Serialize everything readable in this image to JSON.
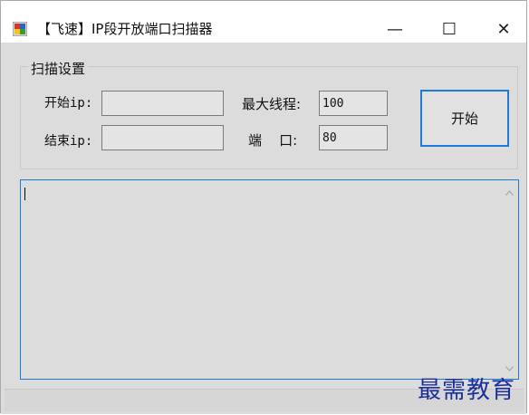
{
  "window": {
    "title": "【飞速】IP段开放端口扫描器",
    "minimize_glyph": "—",
    "maximize_glyph": "☐",
    "close_glyph": "✕"
  },
  "settings": {
    "group_title": "扫描设置",
    "start_ip_label": "开始ip:",
    "start_ip_value": "",
    "end_ip_label": "结束ip:",
    "end_ip_value": "",
    "threads_label": "最大线程:",
    "threads_value": "100",
    "port_label": "端    口:",
    "port_value": "80",
    "start_button": "开始"
  },
  "log": {
    "text": ""
  },
  "watermark": "最需教育",
  "colors": {
    "accent": "#1f7ad4",
    "watermark": "#1c2f9a"
  }
}
